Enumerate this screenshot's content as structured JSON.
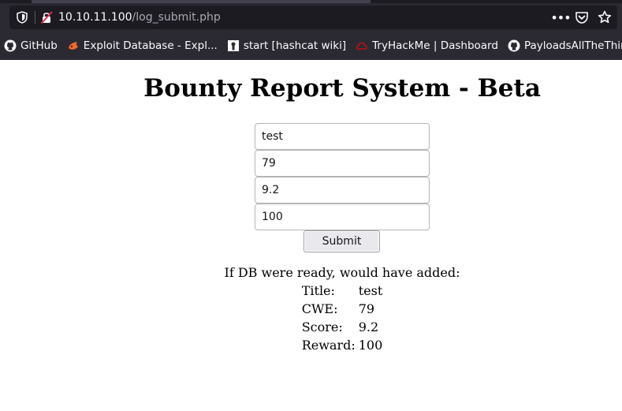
{
  "browser": {
    "url_host": "10.10.11.100",
    "url_path": "/log_submit.php",
    "bookmarks": [
      {
        "label": "GitHub",
        "icon": "github-icon"
      },
      {
        "label": "Exploit Database - Expl...",
        "icon": "exploit-db-icon"
      },
      {
        "label": "start [hashcat wiki]",
        "icon": "hashcat-icon"
      },
      {
        "label": "TryHackMe | Dashboard",
        "icon": "tryhackme-icon"
      },
      {
        "label": "PayloadsAllTheThings",
        "icon": "github-icon"
      }
    ]
  },
  "page": {
    "title": "Bounty Report System - Beta",
    "form": {
      "title_value": "test",
      "cwe_value": "79",
      "score_value": "9.2",
      "reward_value": "100",
      "submit_label": "Submit"
    },
    "result": {
      "heading": "If DB were ready, would have added:",
      "rows": [
        {
          "label": "Title:",
          "value": "test"
        },
        {
          "label": "CWE:",
          "value": "79"
        },
        {
          "label": "Score:",
          "value": "9.2"
        },
        {
          "label": "Reward:",
          "value": "100"
        }
      ]
    }
  }
}
